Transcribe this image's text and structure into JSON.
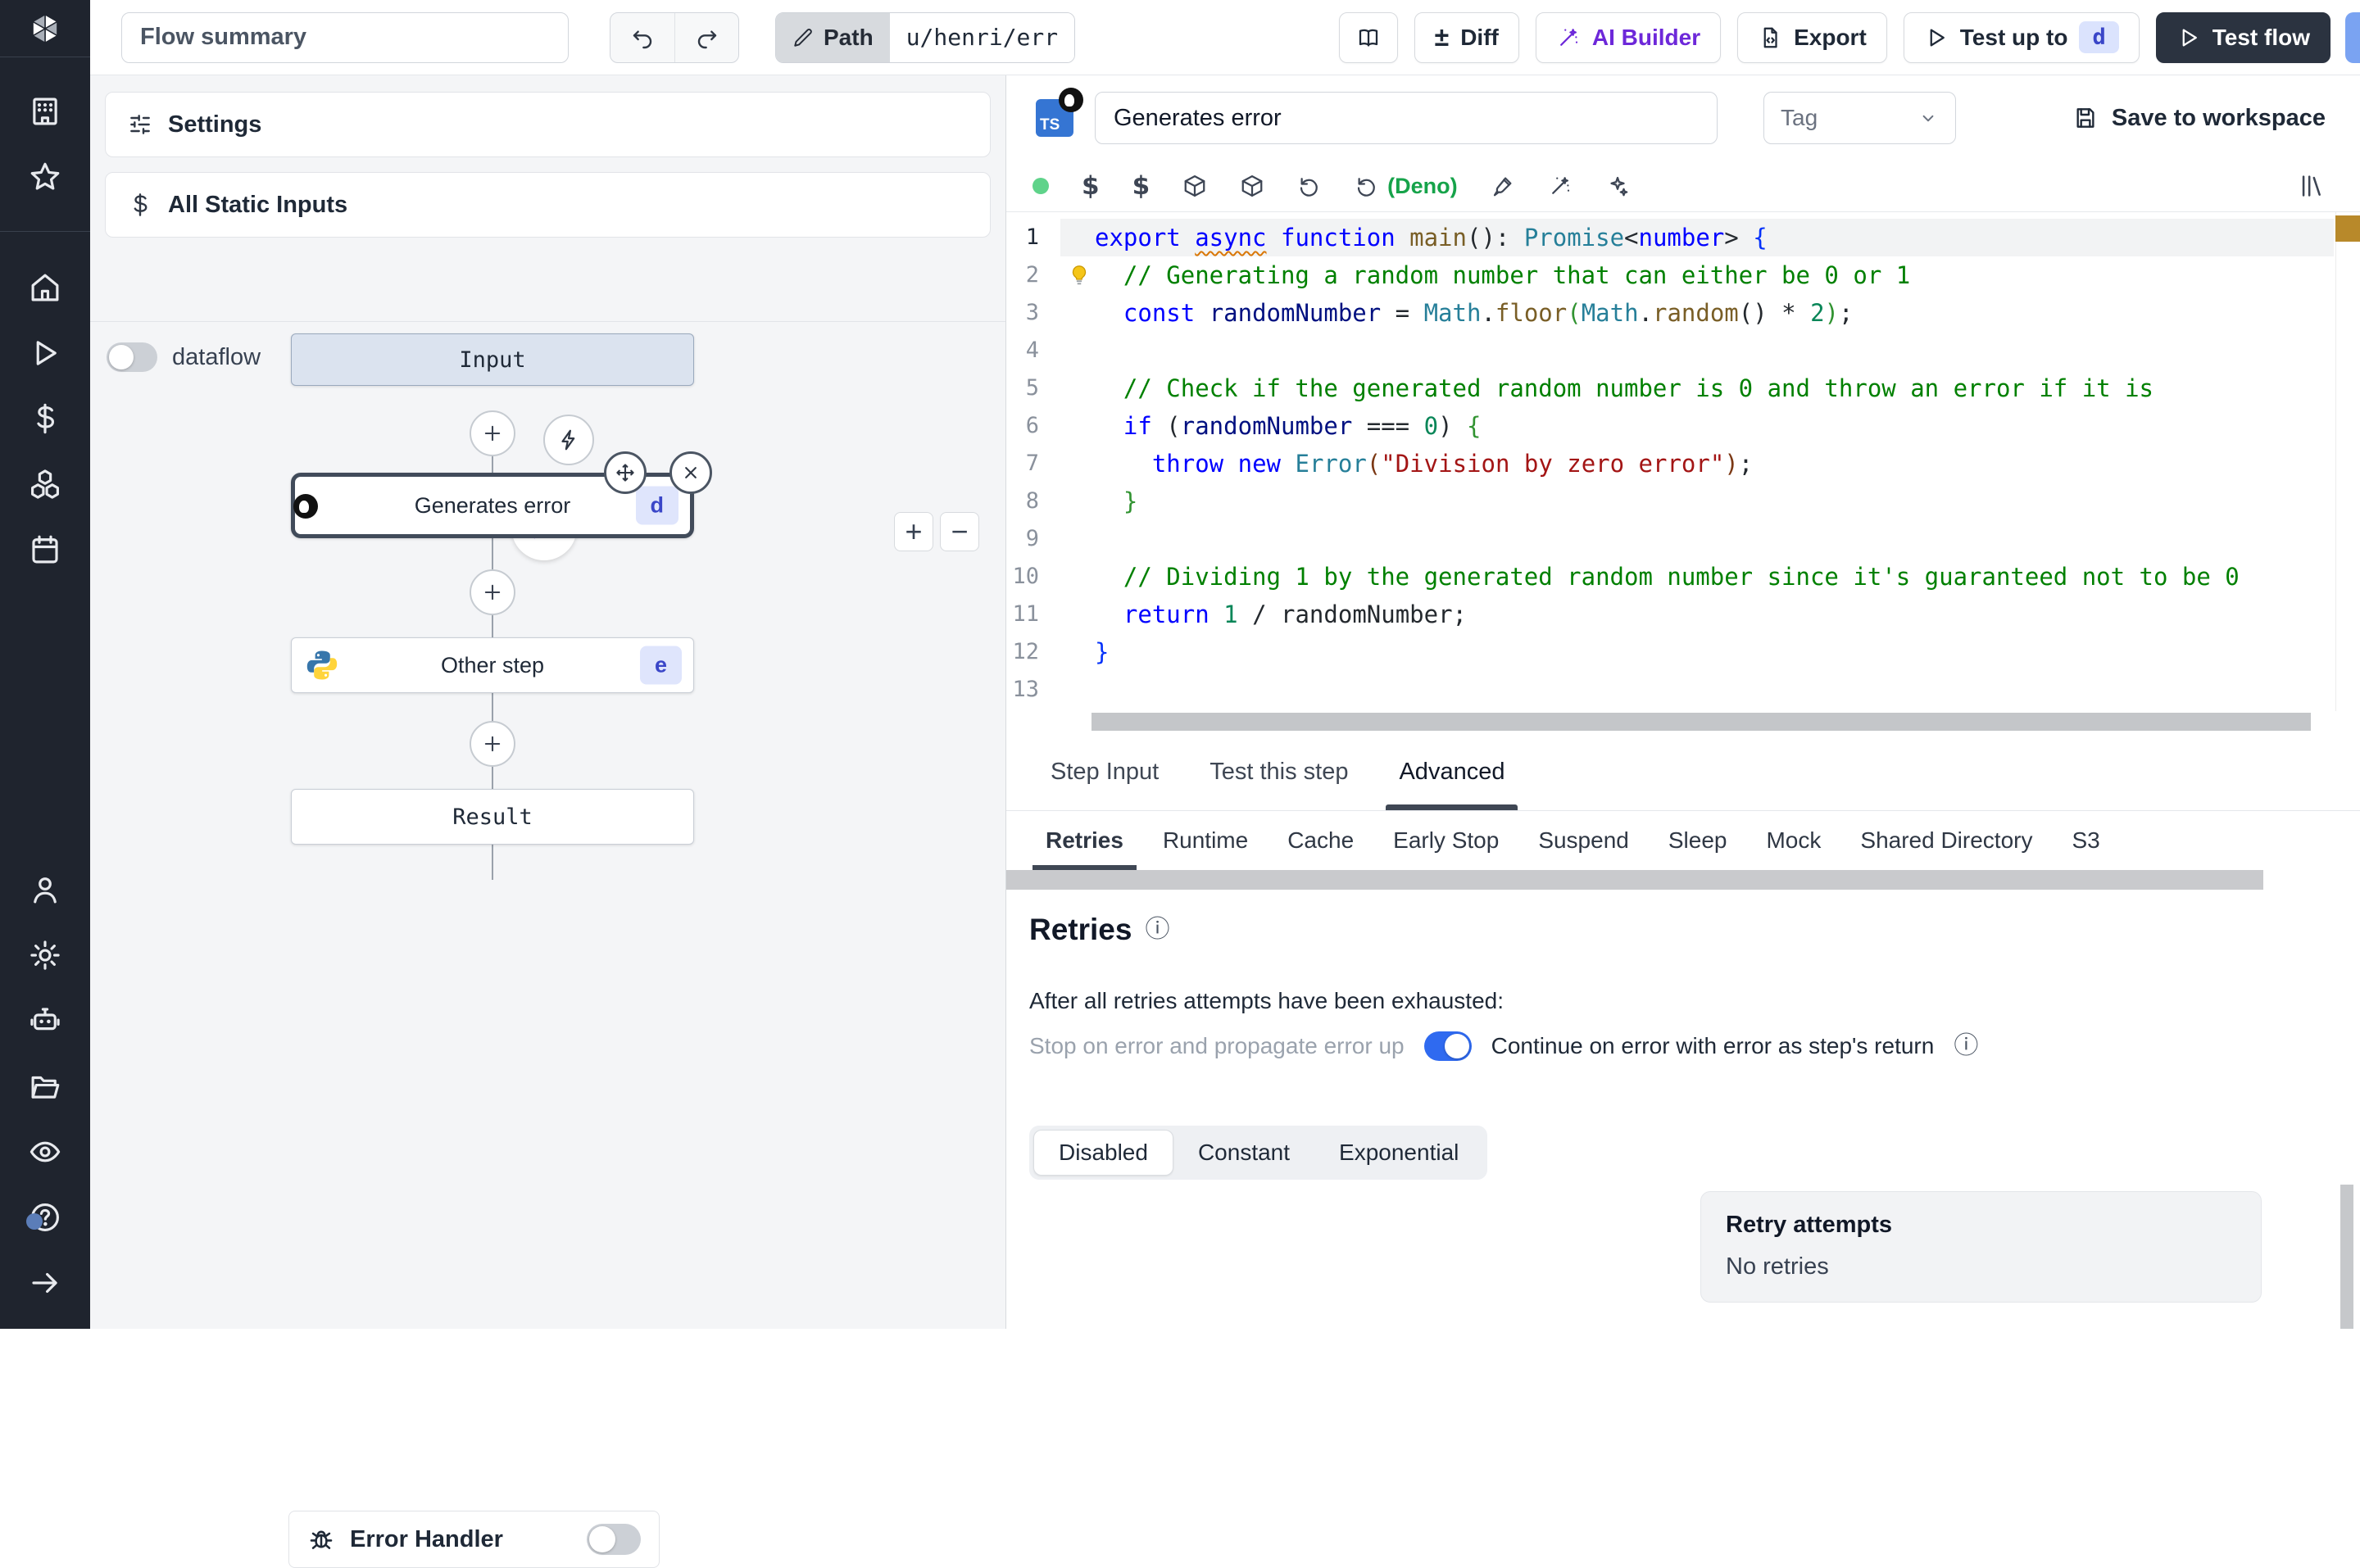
{
  "colors": {
    "sidebar_bg": "#1f242e",
    "accent_purple": "#6d28d9",
    "toggle_blue": "#2f6af0",
    "deno_green": "#16a34a",
    "badge_bg": "#dfe5fc",
    "badge_text": "#3a46c8",
    "dark_button": "#2b3340",
    "overview_marker": "#b8892a"
  },
  "sidebar": {
    "top_icons": [
      "building",
      "star"
    ],
    "main_icons": [
      "home",
      "play",
      "dollar",
      "cubes",
      "calendar"
    ],
    "account_icons": [
      "user",
      "gear",
      "robot",
      "folder",
      "eye"
    ],
    "footer_icons": [
      "help",
      "arrow-right"
    ]
  },
  "topbar": {
    "flow_summary_placeholder": "Flow summary",
    "path_label": "Path",
    "path_value": "u/henri/err",
    "diff_label": "Diff",
    "diff_sign": "±",
    "ai_builder_label": "AI Builder",
    "export_label": "Export",
    "test_up_to_label": "Test up to",
    "test_up_to_badge": "d",
    "test_flow_label": "Test flow"
  },
  "left_panel": {
    "settings_label": "Settings",
    "static_inputs_label": "All Static Inputs",
    "dataflow_label": "dataflow",
    "zoom_in": "+",
    "zoom_out": "−",
    "error_handler_label": "Error Handler"
  },
  "flow": {
    "input_label": "Input",
    "result_label": "Result",
    "steps": [
      {
        "label": "Generates error",
        "badge": "d",
        "lang": "typescript-deno",
        "selected": true
      },
      {
        "label": "Other step",
        "badge": "e",
        "lang": "python",
        "selected": false
      }
    ]
  },
  "step_editor": {
    "name_value": "Generates error",
    "tag_placeholder": "Tag",
    "save_label": "Save to workspace",
    "deno_label": "(Deno)",
    "lang_badge": "TS"
  },
  "editor": {
    "lines": [
      {
        "n": 1,
        "tokens": [
          [
            "export ",
            "kw"
          ],
          [
            "async",
            "kw warn"
          ],
          [
            " ",
            "pl"
          ],
          [
            "function ",
            "kw"
          ],
          [
            "main",
            "fn"
          ],
          [
            "(): ",
            "pl"
          ],
          [
            "Promise",
            "type"
          ],
          [
            "<",
            "pl"
          ],
          [
            "number",
            "kw"
          ],
          [
            "> ",
            "pl"
          ],
          [
            "{",
            "b1"
          ]
        ]
      },
      {
        "n": 2,
        "tokens": [
          [
            "  ",
            "pl"
          ],
          [
            "// Generating a random number that can either be 0 or 1",
            "com"
          ]
        ]
      },
      {
        "n": 3,
        "tokens": [
          [
            "  ",
            "pl"
          ],
          [
            "const ",
            "kw"
          ],
          [
            "randomNumber",
            "var"
          ],
          [
            " = ",
            "pl"
          ],
          [
            "Math",
            "type"
          ],
          [
            ".",
            "pl"
          ],
          [
            "floor",
            "fn"
          ],
          [
            "(",
            "b2"
          ],
          [
            "Math",
            "type"
          ],
          [
            ".",
            "pl"
          ],
          [
            "random",
            "fn"
          ],
          [
            "()",
            "pl"
          ],
          [
            " * ",
            "pl"
          ],
          [
            "2",
            "num"
          ],
          [
            ")",
            "b2"
          ],
          [
            ";",
            "pl"
          ]
        ]
      },
      {
        "n": 4,
        "tokens": []
      },
      {
        "n": 5,
        "tokens": [
          [
            "  ",
            "pl"
          ],
          [
            "// Check if the generated random number is 0 and throw an error if it is",
            "com"
          ]
        ]
      },
      {
        "n": 6,
        "tokens": [
          [
            "  ",
            "pl"
          ],
          [
            "if",
            "kw"
          ],
          [
            " (",
            "pl"
          ],
          [
            "randomNumber",
            "var"
          ],
          [
            " === ",
            "pl"
          ],
          [
            "0",
            "num"
          ],
          [
            ") ",
            "pl"
          ],
          [
            "{",
            "b2"
          ]
        ]
      },
      {
        "n": 7,
        "tokens": [
          [
            "    ",
            "pl"
          ],
          [
            "throw",
            "kw"
          ],
          [
            " ",
            "pl"
          ],
          [
            "new",
            "kw"
          ],
          [
            " ",
            "pl"
          ],
          [
            "Error",
            "type"
          ],
          [
            "(",
            "b3"
          ],
          [
            "\"Division by zero error\"",
            "str"
          ],
          [
            ")",
            "b3"
          ],
          [
            ";",
            "pl"
          ]
        ]
      },
      {
        "n": 8,
        "tokens": [
          [
            "  ",
            "pl"
          ],
          [
            "}",
            "b2"
          ]
        ]
      },
      {
        "n": 9,
        "tokens": []
      },
      {
        "n": 10,
        "tokens": [
          [
            "  ",
            "pl"
          ],
          [
            "// Dividing 1 by the generated random number since it's guaranteed not to be 0",
            "com"
          ]
        ]
      },
      {
        "n": 11,
        "tokens": [
          [
            "  ",
            "pl"
          ],
          [
            "return",
            "kw"
          ],
          [
            " ",
            "pl"
          ],
          [
            "1",
            "num"
          ],
          [
            " / ",
            "pl"
          ],
          [
            "randomNumber",
            "pl"
          ],
          [
            ";",
            "pl"
          ]
        ]
      },
      {
        "n": 12,
        "tokens": [
          [
            "}",
            "b1"
          ]
        ]
      },
      {
        "n": 13,
        "tokens": []
      }
    ]
  },
  "panel": {
    "tabs": [
      "Step Input",
      "Test this step",
      "Advanced"
    ],
    "active_tab": 2,
    "subtabs": [
      "Retries",
      "Runtime",
      "Cache",
      "Early Stop",
      "Suspend",
      "Sleep",
      "Mock",
      "Shared Directory",
      "S3"
    ],
    "active_subtab": 0
  },
  "retries": {
    "title": "Retries",
    "info_glyph": "ⓘ",
    "exhausted_text": "After all retries attempts have been exhausted:",
    "stop_label": "Stop on error and propagate error up",
    "continue_label": "Continue on error with error as step's return",
    "modes": [
      "Disabled",
      "Constant",
      "Exponential"
    ],
    "active_mode": 0,
    "attempts_title": "Retry attempts",
    "attempts_value": "No retries"
  }
}
